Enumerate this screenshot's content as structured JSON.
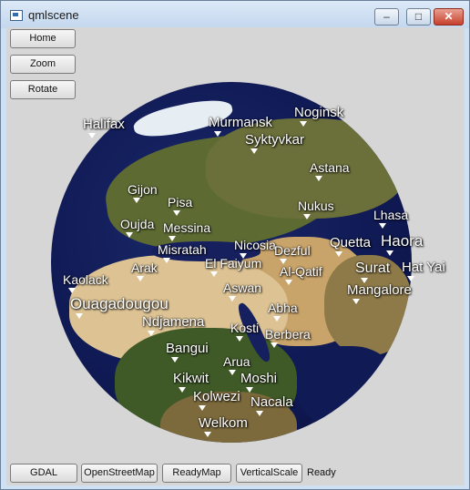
{
  "window": {
    "title": "qmlscene"
  },
  "controls": {
    "minimize": "–",
    "maximize": "□",
    "close": "✕"
  },
  "top_buttons": [
    "Home",
    "Zoom",
    "Rotate"
  ],
  "bottom_buttons": [
    "GDAL",
    "OpenStreetMap",
    "ReadyMap",
    "VerticalScale"
  ],
  "status": "Ready",
  "globe_labels": [
    "Halifax",
    "Murmansk",
    "Noginsk",
    "Syktyvkar",
    "Astana",
    "Gijon",
    "Pisa",
    "Nukus",
    "Lhasa",
    "Oujda",
    "Messina",
    "Misratah",
    "Nicosia",
    "Dezful",
    "Quetta",
    "Haora",
    "Arak",
    "El Faiyum",
    "Al-Qatif",
    "Surat",
    "Hat Yai",
    "Kaolack",
    "Aswan",
    "Mangalore",
    "Ouagadougou",
    "Abha",
    "Ndjamena",
    "Kosti",
    "Berbera",
    "Bangui",
    "Arua",
    "Kikwit",
    "Moshi",
    "Kolwezi",
    "Nacala",
    "Welkom"
  ]
}
